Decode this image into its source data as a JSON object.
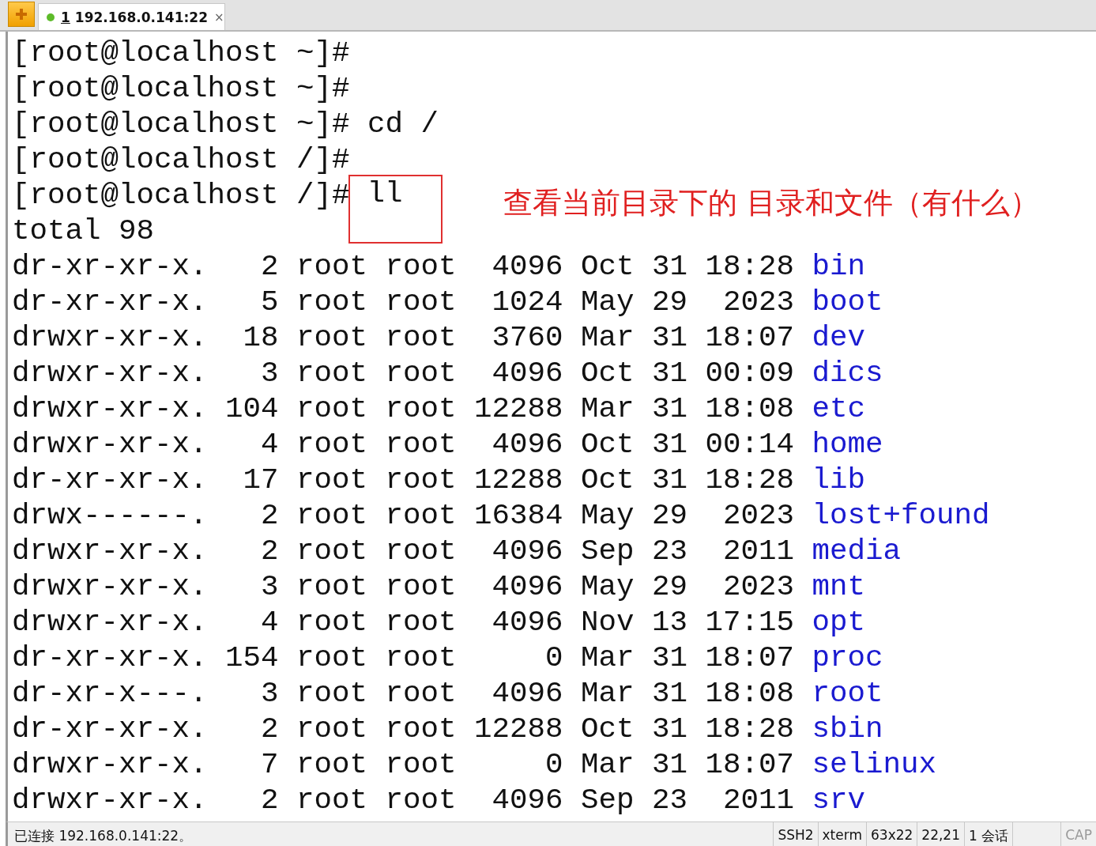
{
  "tab_bar": {
    "tabs": [
      {
        "number": "1",
        "title": "192.168.0.141:22",
        "connected": true,
        "selected": true,
        "close": "×"
      }
    ]
  },
  "terminal": {
    "prompts": [
      {
        "prompt": "[root@localhost ~]#"
      },
      {
        "prompt": "[root@localhost ~]#"
      },
      {
        "prompt": "[root@localhost ~]#",
        "command": "cd /",
        "highlighted": false
      },
      {
        "prompt": "[root@localhost /]#"
      },
      {
        "prompt": "[root@localhost /]#",
        "command": "ll",
        "highlighted": true
      }
    ],
    "annotation": "查看当前目录下的 目录和文件（有什么）",
    "total": "total 98",
    "listing": [
      {
        "perms": "dr-xr-xr-x.",
        "links": "2",
        "owner": "root",
        "group": "root",
        "size": "4096",
        "month": "Oct",
        "day": "31",
        "time": "18:28",
        "name": "bin"
      },
      {
        "perms": "dr-xr-xr-x.",
        "links": "5",
        "owner": "root",
        "group": "root",
        "size": "1024",
        "month": "May",
        "day": "29",
        "time": "2023",
        "name": "boot"
      },
      {
        "perms": "drwxr-xr-x.",
        "links": "18",
        "owner": "root",
        "group": "root",
        "size": "3760",
        "month": "Mar",
        "day": "31",
        "time": "18:07",
        "name": "dev"
      },
      {
        "perms": "drwxr-xr-x.",
        "links": "3",
        "owner": "root",
        "group": "root",
        "size": "4096",
        "month": "Oct",
        "day": "31",
        "time": "00:09",
        "name": "dics"
      },
      {
        "perms": "drwxr-xr-x.",
        "links": "104",
        "owner": "root",
        "group": "root",
        "size": "12288",
        "month": "Mar",
        "day": "31",
        "time": "18:08",
        "name": "etc"
      },
      {
        "perms": "drwxr-xr-x.",
        "links": "4",
        "owner": "root",
        "group": "root",
        "size": "4096",
        "month": "Oct",
        "day": "31",
        "time": "00:14",
        "name": "home"
      },
      {
        "perms": "dr-xr-xr-x.",
        "links": "17",
        "owner": "root",
        "group": "root",
        "size": "12288",
        "month": "Oct",
        "day": "31",
        "time": "18:28",
        "name": "lib"
      },
      {
        "perms": "drwx------.",
        "links": "2",
        "owner": "root",
        "group": "root",
        "size": "16384",
        "month": "May",
        "day": "29",
        "time": "2023",
        "name": "lost+found"
      },
      {
        "perms": "drwxr-xr-x.",
        "links": "2",
        "owner": "root",
        "group": "root",
        "size": "4096",
        "month": "Sep",
        "day": "23",
        "time": "2011",
        "name": "media"
      },
      {
        "perms": "drwxr-xr-x.",
        "links": "3",
        "owner": "root",
        "group": "root",
        "size": "4096",
        "month": "May",
        "day": "29",
        "time": "2023",
        "name": "mnt"
      },
      {
        "perms": "drwxr-xr-x.",
        "links": "4",
        "owner": "root",
        "group": "root",
        "size": "4096",
        "month": "Nov",
        "day": "13",
        "time": "17:15",
        "name": "opt"
      },
      {
        "perms": "dr-xr-xr-x.",
        "links": "154",
        "owner": "root",
        "group": "root",
        "size": "0",
        "month": "Mar",
        "day": "31",
        "time": "18:07",
        "name": "proc"
      },
      {
        "perms": "dr-xr-x---.",
        "links": "3",
        "owner": "root",
        "group": "root",
        "size": "4096",
        "month": "Mar",
        "day": "31",
        "time": "18:08",
        "name": "root"
      },
      {
        "perms": "dr-xr-xr-x.",
        "links": "2",
        "owner": "root",
        "group": "root",
        "size": "12288",
        "month": "Oct",
        "day": "31",
        "time": "18:28",
        "name": "sbin"
      },
      {
        "perms": "drwxr-xr-x.",
        "links": "7",
        "owner": "root",
        "group": "root",
        "size": "0",
        "month": "Mar",
        "day": "31",
        "time": "18:07",
        "name": "selinux"
      },
      {
        "perms": "drwxr-xr-x.",
        "links": "2",
        "owner": "root",
        "group": "root",
        "size": "4096",
        "month": "Sep",
        "day": "23",
        "time": "2011",
        "name": "srv"
      }
    ]
  },
  "status_bar": {
    "message": "已连接 192.168.0.141:22。",
    "cells": [
      {
        "text": "SSH2",
        "disabled": false
      },
      {
        "text": "xterm",
        "disabled": false
      },
      {
        "text": "63x22",
        "disabled": false
      },
      {
        "text": "22,21",
        "disabled": false
      },
      {
        "text": "1 会话",
        "disabled": false
      },
      {
        "text": "CAP",
        "disabled": true
      }
    ]
  }
}
